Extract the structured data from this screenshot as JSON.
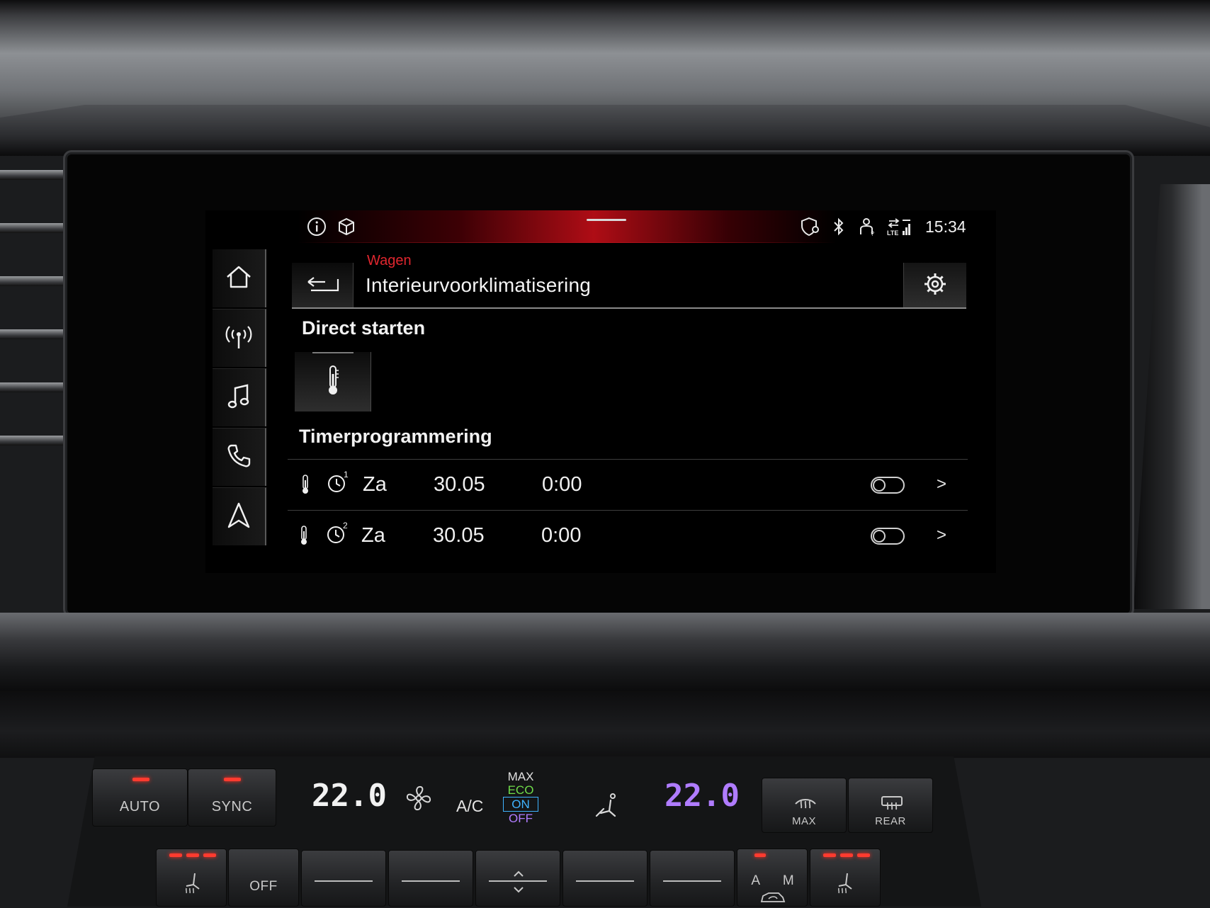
{
  "status_bar": {
    "time": "15:34",
    "icons_left": [
      "info-icon",
      "package-icon"
    ],
    "icons_right": [
      "location-shield-icon",
      "bluetooth-icon",
      "user-icon",
      "lte-signal-icon"
    ]
  },
  "nav": {
    "items": [
      {
        "name": "home",
        "icon": "home-icon"
      },
      {
        "name": "radio",
        "icon": "radio-icon"
      },
      {
        "name": "media",
        "icon": "music-icon"
      },
      {
        "name": "phone",
        "icon": "phone-icon"
      },
      {
        "name": "navigation",
        "icon": "navigation-icon"
      }
    ]
  },
  "header": {
    "breadcrumb": "Wagen",
    "title": "Interieurvoorklimatisering"
  },
  "sections": {
    "direct_start": "Direct starten",
    "timer": "Timerprogrammering"
  },
  "timers": [
    {
      "timer_no": "1",
      "day": "Za",
      "date": "30.05",
      "time": "0:00",
      "enabled": false
    },
    {
      "timer_no": "2",
      "day": "Za",
      "date": "30.05",
      "time": "0:00",
      "enabled": false
    }
  ],
  "chevron": ">",
  "climate": {
    "auto_label": "AUTO",
    "sync_label": "SYNC",
    "off_label": "OFF",
    "temp_left": "22.0",
    "temp_right": "22.0",
    "ac_label": "A/C",
    "ac_options": [
      "MAX",
      "ECO",
      "ON",
      "OFF"
    ],
    "max_defrost_label": "MAX",
    "rear_defrost_label": "REAR",
    "recirc_a": "A",
    "recirc_m": "M",
    "colors": {
      "led": "#ff3b2f",
      "temp_right": "#b07cff",
      "eco": "#6fdc4a",
      "on": "#3fb3ff"
    }
  },
  "colors": {
    "accent": "#e0262e",
    "screen_bg": "#000000",
    "text": "#f2f2f2"
  }
}
